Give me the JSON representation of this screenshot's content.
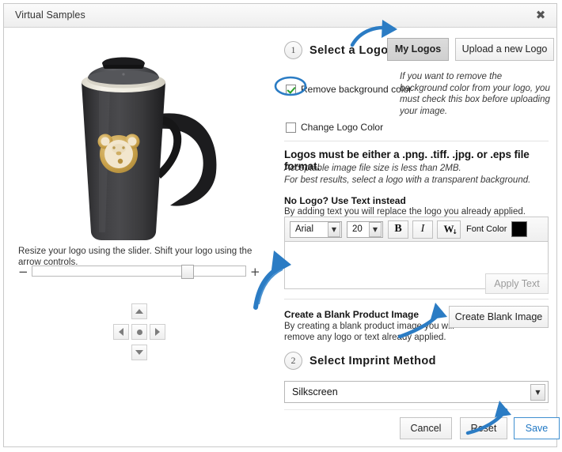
{
  "window": {
    "title": "Virtual Samples",
    "close_icon": "close-icon",
    "close_glyph": "✖"
  },
  "preview": {
    "caption": "Resize your logo using the slider. Shift your logo using the arrow controls.",
    "slider": {
      "minus": "−",
      "plus": "+",
      "value_percent": 73
    },
    "nudge": {
      "up": "▲",
      "left": "◀",
      "center": "●",
      "right": "▶",
      "down": "▼"
    },
    "product": {
      "name": "black travel mug",
      "body_color": "#3a3a3c",
      "rim_color": "#f2efe6",
      "lid_color": "#55565a",
      "logo_name": "bear-face-logo",
      "logo_gold": "#c9a14a",
      "logo_cream": "#f2e6cd"
    }
  },
  "step1": {
    "number": "1",
    "label": "Select a Logo",
    "my_logos_button": "My Logos",
    "upload_button": "Upload a new Logo",
    "remove_bg_label": "Remove background color",
    "remove_bg_checked": true,
    "remove_bg_help": "If you want to remove the background color from your logo, you must check this box before uploading your image.",
    "change_color_label": "Change Logo Color",
    "change_color_checked": false
  },
  "formats": {
    "headline": "Logos must be either a .png. .tiff. .jpg. or .eps file format.",
    "line1": "Acceptable image file size is less than 2MB.",
    "line2": "For best results, select a logo with a transparent background."
  },
  "text_tool": {
    "headline": "No Logo? Use Text instead",
    "subline": "By adding text you will replace the logo you already applied.",
    "font_family_value": "Arial",
    "font_size_value": "20",
    "bold_label": "B",
    "italic_label": "I",
    "wordart_label": "W",
    "wordart_arrow": "↓",
    "font_color_label": "Font Color",
    "font_color_value": "#000000",
    "textarea_value": "",
    "textarea_placeholder": "",
    "apply_button": "Apply Text",
    "apply_enabled": false,
    "dropdown_glyph": "▼"
  },
  "blank_image": {
    "headline": "Create a Blank Product Image",
    "subline": "By creating a blank product image you will remove any logo or text already applied.",
    "button": "Create Blank Image"
  },
  "step2": {
    "number": "2",
    "label": "Select Imprint Method",
    "imprint_value": "Silkscreen",
    "dropdown_glyph": "▼"
  },
  "footer": {
    "cancel": "Cancel",
    "reset": "Reset",
    "save": "Save",
    "save_accent": "#1f77c4"
  },
  "annotations": {
    "color": "#2b7cc4",
    "arrow_to_my_logos": "arrow pointing to My Logos button",
    "ellipse_on_checkbox": "ellipse circling Remove background color checkbox",
    "arrow_to_textarea": "large arrow pointing to text entry box",
    "arrow_to_blank_image": "arrow pointing to Create Blank Image button",
    "arrow_to_save": "arrow pointing to Save button"
  }
}
